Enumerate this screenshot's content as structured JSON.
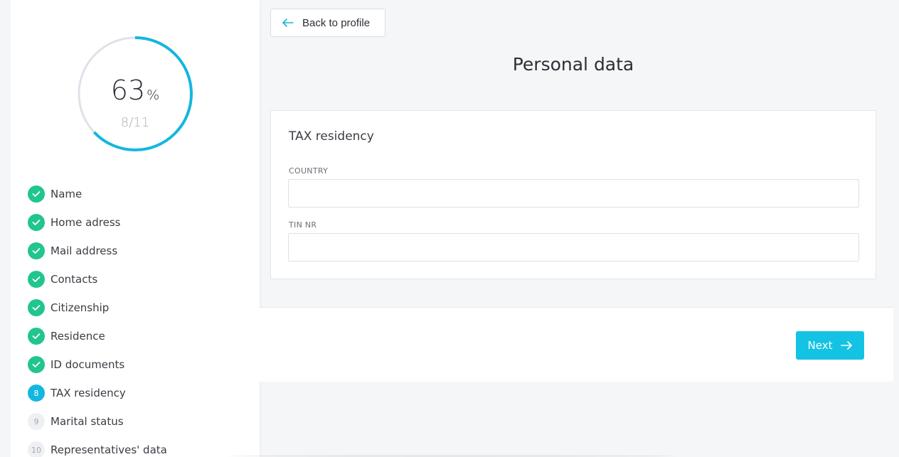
{
  "progress": {
    "percent": "63",
    "percent_sign": "%",
    "count": "8/11",
    "fraction": 0.63,
    "track_color": "#dde3e9",
    "fill_color": "#14b6e0"
  },
  "steps": [
    {
      "label": "Name",
      "status": "done"
    },
    {
      "label": "Home adress",
      "status": "done"
    },
    {
      "label": "Mail address",
      "status": "done"
    },
    {
      "label": "Contacts",
      "status": "done"
    },
    {
      "label": "Citizenship",
      "status": "done"
    },
    {
      "label": "Residence",
      "status": "done"
    },
    {
      "label": "ID documents",
      "status": "done"
    },
    {
      "label": "TAX residency",
      "status": "current",
      "number": "8"
    },
    {
      "label": "Marital status",
      "status": "pending",
      "number": "9"
    },
    {
      "label": "Representatives' data",
      "status": "pending",
      "number": "10"
    }
  ],
  "header": {
    "back_label": "Back to profile",
    "title": "Personal data"
  },
  "form": {
    "section_title": "TAX residency",
    "country_label": "COUNTRY",
    "country_value": "",
    "tin_label": "TIN NR",
    "tin_value": ""
  },
  "footer": {
    "next_label": "Next"
  },
  "colors": {
    "done": "#21c58e",
    "current": "#14b6e0",
    "accent_button": "#14c3e3"
  },
  "icons": {
    "back": "arrow-left-icon",
    "next": "arrow-right-icon",
    "done": "check-icon"
  }
}
